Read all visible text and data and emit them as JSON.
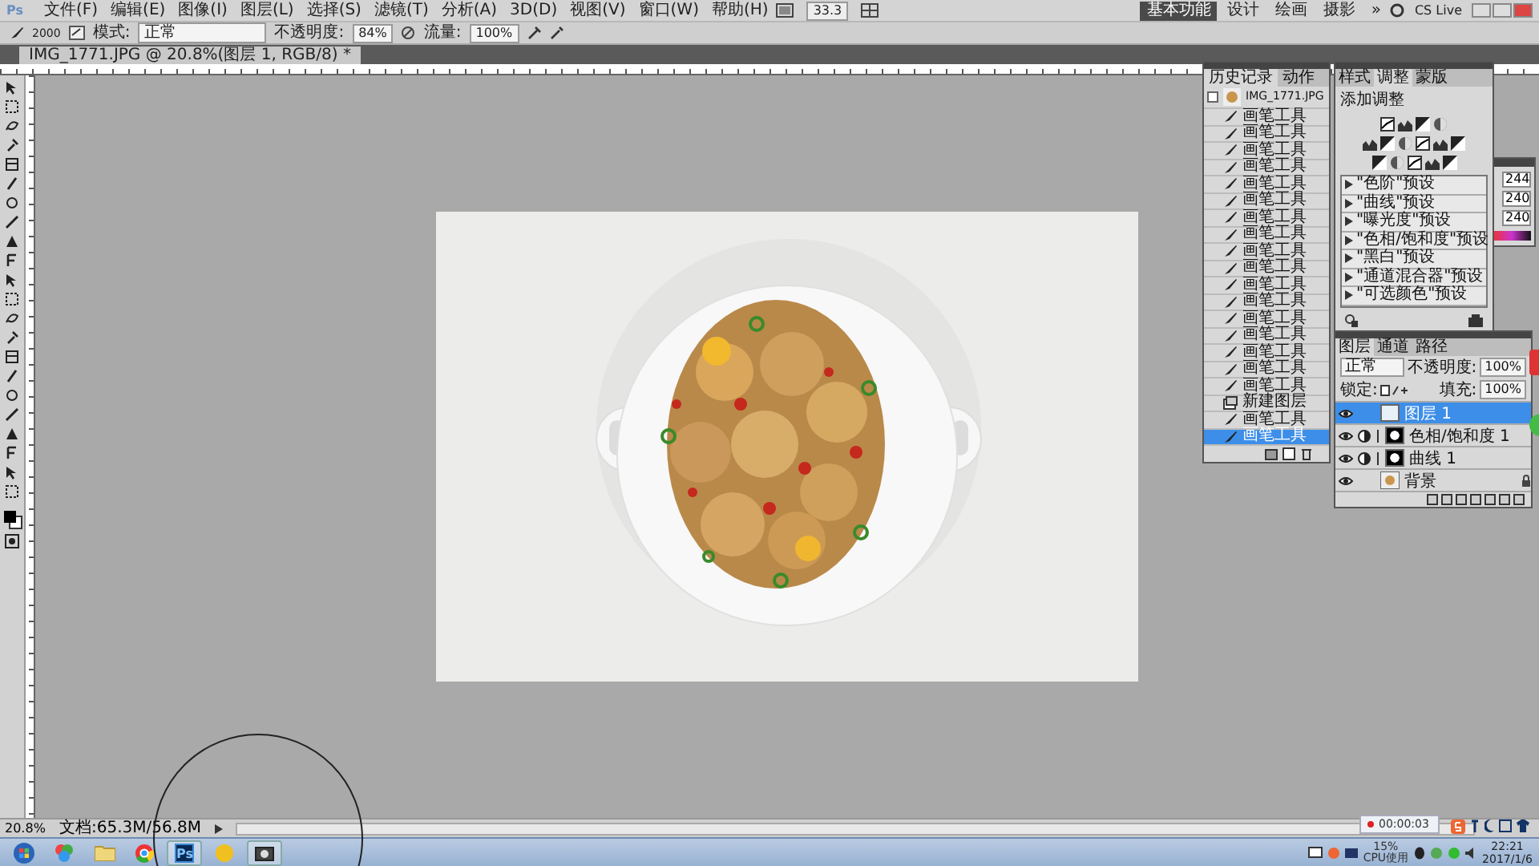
{
  "menu_bar": {
    "app_icon": "Ps",
    "items": [
      "文件(F)",
      "编辑(E)",
      "图像(I)",
      "图层(L)",
      "选择(S)",
      "滤镜(T)",
      "分析(A)",
      "3D(D)",
      "视图(V)",
      "窗口(W)",
      "帮助(H)"
    ],
    "zoom": "33.3",
    "workspaces": [
      {
        "label": "基本功能",
        "selected": true
      },
      {
        "label": "设计",
        "selected": false
      },
      {
        "label": "绘画",
        "selected": false
      },
      {
        "label": "摄影",
        "selected": false
      }
    ],
    "more": "»",
    "cs_live": "CS Live"
  },
  "options_bar": {
    "brush_size": "2000",
    "mode_label": "模式:",
    "mode": "正常",
    "opacity_label": "不透明度:",
    "opacity": "84%",
    "flow_label": "流量:",
    "flow": "100%"
  },
  "document_tab": {
    "title": "IMG_1771.JPG @ 20.8%(图层 1, RGB/8) *"
  },
  "history_panel": {
    "tabs": [
      {
        "label": "历史记录",
        "selected": true
      },
      {
        "label": "动作",
        "selected": false
      }
    ],
    "snapshot": "IMG_1771.JPG",
    "steps": [
      {
        "label": "画笔工具",
        "kind": "brush",
        "selected": false
      },
      {
        "label": "画笔工具",
        "kind": "brush",
        "selected": false
      },
      {
        "label": "画笔工具",
        "kind": "brush",
        "selected": false
      },
      {
        "label": "画笔工具",
        "kind": "brush",
        "selected": false
      },
      {
        "label": "画笔工具",
        "kind": "brush",
        "selected": false
      },
      {
        "label": "画笔工具",
        "kind": "brush",
        "selected": false
      },
      {
        "label": "画笔工具",
        "kind": "brush",
        "selected": false
      },
      {
        "label": "画笔工具",
        "kind": "brush",
        "selected": false
      },
      {
        "label": "画笔工具",
        "kind": "brush",
        "selected": false
      },
      {
        "label": "画笔工具",
        "kind": "brush",
        "selected": false
      },
      {
        "label": "画笔工具",
        "kind": "brush",
        "selected": false
      },
      {
        "label": "画笔工具",
        "kind": "brush",
        "selected": false
      },
      {
        "label": "画笔工具",
        "kind": "brush",
        "selected": false
      },
      {
        "label": "画笔工具",
        "kind": "brush",
        "selected": false
      },
      {
        "label": "画笔工具",
        "kind": "brush",
        "selected": false
      },
      {
        "label": "画笔工具",
        "kind": "brush",
        "selected": false
      },
      {
        "label": "画笔工具",
        "kind": "brush",
        "selected": false
      },
      {
        "label": "新建图层",
        "kind": "layer",
        "selected": false
      },
      {
        "label": "画笔工具",
        "kind": "brush",
        "selected": false
      },
      {
        "label": "画笔工具",
        "kind": "brush",
        "selected": true
      }
    ]
  },
  "adjustments_panel": {
    "tabs": [
      {
        "label": "样式",
        "selected": false
      },
      {
        "label": "调整",
        "selected": true
      },
      {
        "label": "蒙版",
        "selected": false
      }
    ],
    "title": "添加调整",
    "presets": [
      "\"色阶\"预设",
      "\"曲线\"预设",
      "\"曝光度\"预设",
      "\"色相/饱和度\"预设",
      "\"黑白\"预设",
      "\"通道混合器\"预设",
      "\"可选颜色\"预设"
    ]
  },
  "color_panel": {
    "values": [
      "244",
      "240",
      "240"
    ]
  },
  "layers_panel": {
    "tabs": [
      {
        "label": "图层",
        "selected": true
      },
      {
        "label": "通道",
        "selected": false
      },
      {
        "label": "路径",
        "selected": false
      }
    ],
    "blend_mode": "正常",
    "opacity_label": "不透明度:",
    "opacity": "100%",
    "lock_label": "锁定:",
    "fill_label": "填充:",
    "fill": "100%",
    "layers": [
      {
        "name": "图层 1",
        "kind": "pixel",
        "selected": true,
        "visible": true
      },
      {
        "name": "色相/饱和度 1",
        "kind": "adjustment",
        "selected": false,
        "visible": true
      },
      {
        "name": "曲线 1",
        "kind": "adjustment",
        "selected": false,
        "visible": true
      },
      {
        "name": "背景",
        "kind": "background",
        "selected": false,
        "visible": true
      }
    ]
  },
  "status_bar": {
    "zoom": "20.8%",
    "document": "文档:65.3M/56.8M"
  },
  "recorder": {
    "time": "00:00:03"
  },
  "taskbar": {
    "ps_label": "Ps",
    "cpu": "15%",
    "cpu_label": "CPU使用",
    "time": "22:21",
    "date": "2017/1/6"
  }
}
